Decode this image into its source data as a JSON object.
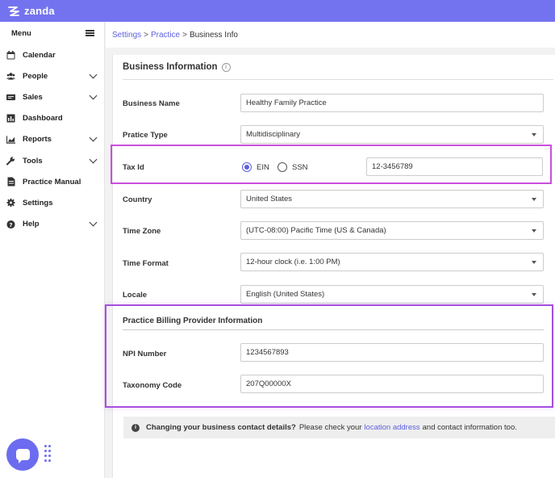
{
  "brand": {
    "name": "zanda"
  },
  "sidebar": {
    "menu_label": "Menu",
    "items": [
      {
        "label": "Calendar",
        "icon": "calendar-icon",
        "has_children": false
      },
      {
        "label": "People",
        "icon": "people-icon",
        "has_children": true
      },
      {
        "label": "Sales",
        "icon": "sales-icon",
        "has_children": true
      },
      {
        "label": "Dashboard",
        "icon": "dashboard-icon",
        "has_children": false
      },
      {
        "label": "Reports",
        "icon": "reports-icon",
        "has_children": true
      },
      {
        "label": "Tools",
        "icon": "wrench-icon",
        "has_children": true
      },
      {
        "label": "Practice Manual",
        "icon": "document-icon",
        "has_children": false
      },
      {
        "label": "Settings",
        "icon": "gear-icon",
        "has_children": false
      },
      {
        "label": "Help",
        "icon": "help-icon",
        "has_children": true
      }
    ]
  },
  "breadcrumb": {
    "first": "Settings",
    "sep1": ">",
    "second": "Practice",
    "sep2": ">",
    "current": "Business Info"
  },
  "section": {
    "title": "Business Information",
    "fields": {
      "business_name": {
        "label": "Business Name",
        "value": "Healthy Family Practice"
      },
      "practice_type": {
        "label": "Pratice Type",
        "value": "Multidisciplinary"
      },
      "tax_id": {
        "label": "Tax Id",
        "option_ein": "EIN",
        "option_ssn": "SSN",
        "selected": "EIN",
        "value": "12-3456789"
      },
      "country": {
        "label": "Country",
        "value": "United States"
      },
      "time_zone": {
        "label": "Time Zone",
        "value": "(UTC-08:00) Pacific Time (US & Canada)"
      },
      "time_format": {
        "label": "Time Format",
        "value": "12-hour clock (i.e. 1:00 PM)"
      },
      "locale": {
        "label": "Locale",
        "value": "English (United States)"
      }
    }
  },
  "billing": {
    "title": "Practice Billing Provider Information",
    "npi": {
      "label": "NPI Number",
      "value": "1234567893"
    },
    "taxonomy": {
      "label": "Taxonomy Code",
      "value": "207Q00000X"
    }
  },
  "notice": {
    "bold": "Changing your business contact details?",
    "text_before": "Please check your",
    "link": "location address",
    "text_after": "and contact information too."
  },
  "colors": {
    "accent": "#7473ef",
    "link": "#5d5fe0",
    "highlight_taxid": "#c94fdc",
    "highlight_billing": "#a64fe0"
  }
}
